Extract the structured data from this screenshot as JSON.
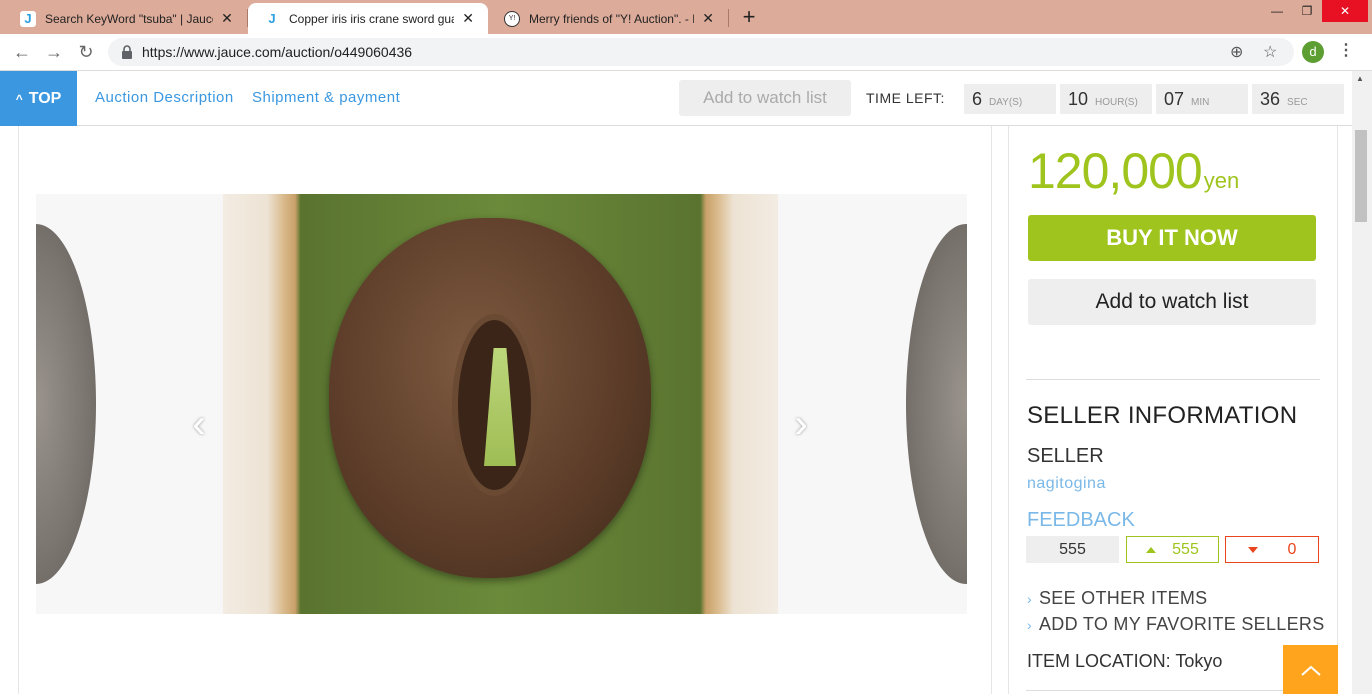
{
  "browser": {
    "tabs": [
      {
        "title": "Search KeyWord \"tsuba\" | Jauce Shopping Service",
        "favicon": "J"
      },
      {
        "title": "Copper iris iris crane sword guard",
        "favicon": "J"
      },
      {
        "title": "Merry friends of \"Y! Auction\". - Pl",
        "favicon": "Y!"
      }
    ],
    "new_tab": "+",
    "close_glyph": "✕",
    "url": "https://www.jauce.com/auction/o449060436",
    "profile_initial": "d",
    "window": {
      "minimize": "—",
      "restore": "❐",
      "close": "✕"
    }
  },
  "subnav": {
    "top_label": "TOP",
    "links": [
      "Auction Description",
      "Shipment & payment"
    ],
    "watch_label": "Add to watch list",
    "time_left_label": "TIME LEFT:",
    "countdown": [
      {
        "value": "6",
        "unit": "DAY(S)"
      },
      {
        "value": "10",
        "unit": "HOUR(S)"
      },
      {
        "value": "07",
        "unit": "MIN"
      },
      {
        "value": "36",
        "unit": "SEC"
      }
    ]
  },
  "gallery": {
    "prev": "‹",
    "next": "›"
  },
  "purchase": {
    "price": "120,000",
    "currency": "yen",
    "buy_label": "BUY IT NOW",
    "watch_label": "Add to watch list"
  },
  "seller": {
    "section_title": "SELLER INFORMATION",
    "seller_label": "SELLER",
    "seller_name": "nagitogina",
    "feedback_label": "FEEDBACK",
    "feedback_total": "555",
    "feedback_positive": "555",
    "feedback_negative": "0",
    "links": [
      "SEE OTHER ITEMS",
      "ADD TO MY FAVORITE SELLERS"
    ],
    "location_label": "ITEM LOCATION:",
    "location_value": "Tokyo"
  },
  "colors": {
    "accent_green": "#9ec41d",
    "link_blue": "#3b98e0",
    "negative_red": "#e8451e",
    "scroll_top_orange": "#ffa41c"
  }
}
